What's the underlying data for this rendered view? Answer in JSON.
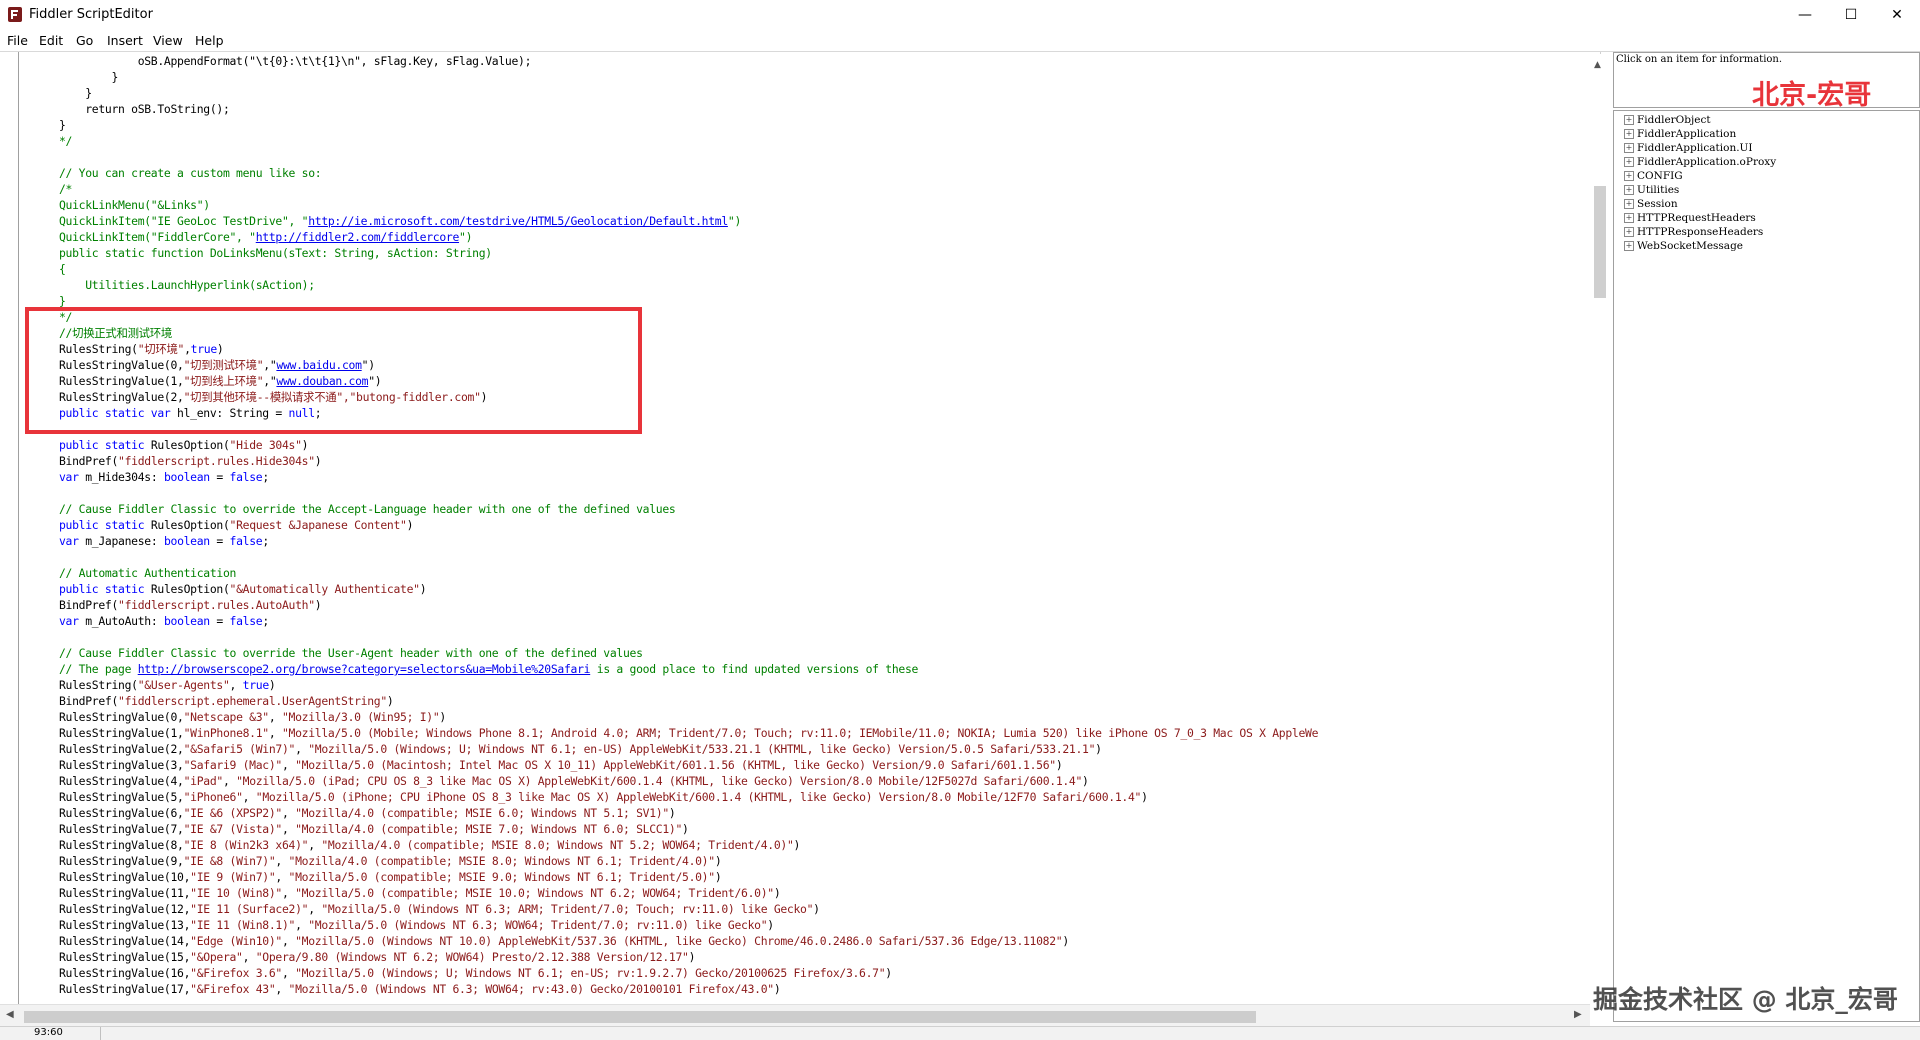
{
  "window": {
    "title": "Fiddler ScriptEditor",
    "minimize_symbol": "—",
    "maximize_symbol": "☐",
    "close_symbol": "✕",
    "icon": "fiddler-icon"
  },
  "menu": [
    "File",
    "Edit",
    "Go",
    "Insert",
    "View",
    "Help"
  ],
  "info_panel": {
    "hint": "Click on an item for information.",
    "watermark": "北京-宏哥"
  },
  "tree": [
    {
      "label": "FiddlerObject",
      "expander": "+"
    },
    {
      "label": "FiddlerApplication",
      "expander": "+"
    },
    {
      "label": "FiddlerApplication.UI",
      "expander": "+"
    },
    {
      "label": "FiddlerApplication.oProxy",
      "expander": "+"
    },
    {
      "label": "CONFIG",
      "expander": "+"
    },
    {
      "label": "Utilities",
      "expander": "+"
    },
    {
      "label": "Session",
      "expander": "+"
    },
    {
      "label": "HTTPRequestHeaders",
      "expander": "+"
    },
    {
      "label": "HTTPResponseHeaders",
      "expander": "+"
    },
    {
      "label": "WebSocketMessage",
      "expander": "+"
    }
  ],
  "code_lines": [
    [
      [
        "p",
        "            oSB.AppendFormat(\"\\t{0}:\\t\\t{1}\\n\", sFlag.Key, sFlag.Value);"
      ]
    ],
    [
      [
        "p",
        "        }"
      ]
    ],
    [
      [
        "p",
        "    }"
      ]
    ],
    [
      [
        "p",
        "    return oSB.ToString();"
      ]
    ],
    [
      [
        "p",
        "}"
      ]
    ],
    [
      [
        "c",
        "*/"
      ]
    ],
    [
      [
        "p",
        ""
      ]
    ],
    [
      [
        "c",
        "// You can create a custom menu like so:"
      ]
    ],
    [
      [
        "c",
        "/*"
      ]
    ],
    [
      [
        "c",
        "QuickLinkMenu(\"&Links\")"
      ]
    ],
    [
      [
        "c",
        "QuickLinkItem(\"IE GeoLoc TestDrive\", \""
      ],
      [
        "u",
        "http://ie.microsoft.com/testdrive/HTML5/Geolocation/Default.html"
      ],
      [
        "c",
        "\")"
      ]
    ],
    [
      [
        "c",
        "QuickLinkItem(\"FiddlerCore\", \""
      ],
      [
        "u",
        "http://fiddler2.com/fiddlercore"
      ],
      [
        "c",
        "\")"
      ]
    ],
    [
      [
        "c",
        "public static function DoLinksMenu(sText: String, sAction: String)"
      ]
    ],
    [
      [
        "c",
        "{"
      ]
    ],
    [
      [
        "c",
        "    Utilities.LaunchHyperlink(sAction);"
      ]
    ],
    [
      [
        "c",
        "}"
      ]
    ],
    [
      [
        "c",
        "*/"
      ]
    ],
    [
      [
        "c",
        "//切换正式和测试环境"
      ]
    ],
    [
      [
        "p",
        "RulesString("
      ],
      [
        "s",
        "\"切环境\""
      ],
      [
        "p",
        ","
      ],
      [
        "k",
        "true"
      ],
      [
        "p",
        ")"
      ]
    ],
    [
      [
        "p",
        "RulesStringValue(0,"
      ],
      [
        "s",
        "\"切到测试环境\""
      ],
      [
        "p",
        ",\""
      ],
      [
        "u",
        "www.baidu.com"
      ],
      [
        "p",
        "\")"
      ]
    ],
    [
      [
        "p",
        "RulesStringValue(1,"
      ],
      [
        "s",
        "\"切到线上环境\""
      ],
      [
        "p",
        ",\""
      ],
      [
        "u",
        "www.douban.com"
      ],
      [
        "p",
        "\")"
      ]
    ],
    [
      [
        "p",
        "RulesStringValue(2,"
      ],
      [
        "s",
        "\"切到其他环境--模拟请求不通\",\"butong-fiddler.com\""
      ],
      [
        "p",
        ")"
      ]
    ],
    [
      [
        "k",
        "public static var"
      ],
      [
        "p",
        " hl_env: String = "
      ],
      [
        "k",
        "null"
      ],
      [
        "p",
        ";"
      ]
    ],
    [
      [
        "p",
        ""
      ]
    ],
    [
      [
        "k",
        "public static"
      ],
      [
        "p",
        " RulesOption("
      ],
      [
        "s",
        "\"Hide 304s\""
      ],
      [
        "p",
        ")"
      ]
    ],
    [
      [
        "p",
        "BindPref("
      ],
      [
        "s",
        "\"fiddlerscript.rules.Hide304s\""
      ],
      [
        "p",
        ")"
      ]
    ],
    [
      [
        "k",
        "var"
      ],
      [
        "p",
        " m_Hide304s: "
      ],
      [
        "k",
        "boolean"
      ],
      [
        "p",
        " = "
      ],
      [
        "k",
        "false"
      ],
      [
        "p",
        ";"
      ]
    ],
    [
      [
        "p",
        ""
      ]
    ],
    [
      [
        "c",
        "// Cause Fiddler Classic to override the Accept-Language header with one of the defined values"
      ]
    ],
    [
      [
        "k",
        "public static"
      ],
      [
        "p",
        " RulesOption("
      ],
      [
        "s",
        "\"Request &Japanese Content\""
      ],
      [
        "p",
        ")"
      ]
    ],
    [
      [
        "k",
        "var"
      ],
      [
        "p",
        " m_Japanese: "
      ],
      [
        "k",
        "boolean"
      ],
      [
        "p",
        " = "
      ],
      [
        "k",
        "false"
      ],
      [
        "p",
        ";"
      ]
    ],
    [
      [
        "p",
        ""
      ]
    ],
    [
      [
        "c",
        "// Automatic Authentication"
      ]
    ],
    [
      [
        "k",
        "public static"
      ],
      [
        "p",
        " RulesOption("
      ],
      [
        "s",
        "\"&Automatically Authenticate\""
      ],
      [
        "p",
        ")"
      ]
    ],
    [
      [
        "p",
        "BindPref("
      ],
      [
        "s",
        "\"fiddlerscript.rules.AutoAuth\""
      ],
      [
        "p",
        ")"
      ]
    ],
    [
      [
        "k",
        "var"
      ],
      [
        "p",
        " m_AutoAuth: "
      ],
      [
        "k",
        "boolean"
      ],
      [
        "p",
        " = "
      ],
      [
        "k",
        "false"
      ],
      [
        "p",
        ";"
      ]
    ],
    [
      [
        "p",
        ""
      ]
    ],
    [
      [
        "c",
        "// Cause Fiddler Classic to override the User-Agent header with one of the defined values"
      ]
    ],
    [
      [
        "c",
        "// The page "
      ],
      [
        "u",
        "http://browserscope2.org/browse?category=selectors&ua=Mobile%20Safari"
      ],
      [
        "c",
        " is a good place to find updated versions of these"
      ]
    ],
    [
      [
        "p",
        "RulesString("
      ],
      [
        "s",
        "\"&User-Agents\""
      ],
      [
        "p",
        ", "
      ],
      [
        "k",
        "true"
      ],
      [
        "p",
        ")"
      ]
    ],
    [
      [
        "p",
        "BindPref("
      ],
      [
        "s",
        "\"fiddlerscript.ephemeral.UserAgentString\""
      ],
      [
        "p",
        ")"
      ]
    ],
    [
      [
        "p",
        "RulesStringValue(0,"
      ],
      [
        "s",
        "\"Netscape &3\""
      ],
      [
        "p",
        ", "
      ],
      [
        "s",
        "\"Mozilla/3.0 (Win95; I)\""
      ],
      [
        "p",
        ")"
      ]
    ],
    [
      [
        "p",
        "RulesStringValue(1,"
      ],
      [
        "s",
        "\"WinPhone8.1\""
      ],
      [
        "p",
        ", "
      ],
      [
        "s",
        "\"Mozilla/5.0 (Mobile; Windows Phone 8.1; Android 4.0; ARM; Trident/7.0; Touch; rv:11.0; IEMobile/11.0; NOKIA; Lumia 520) like iPhone OS 7_0_3 Mac OS X AppleWe"
      ]
    ],
    [
      [
        "p",
        "RulesStringValue(2,"
      ],
      [
        "s",
        "\"&Safari5 (Win7)\""
      ],
      [
        "p",
        ", "
      ],
      [
        "s",
        "\"Mozilla/5.0 (Windows; U; Windows NT 6.1; en-US) AppleWebKit/533.21.1 (KHTML, like Gecko) Version/5.0.5 Safari/533.21.1\""
      ],
      [
        "p",
        ")"
      ]
    ],
    [
      [
        "p",
        "RulesStringValue(3,"
      ],
      [
        "s",
        "\"Safari9 (Mac)\""
      ],
      [
        "p",
        ", "
      ],
      [
        "s",
        "\"Mozilla/5.0 (Macintosh; Intel Mac OS X 10_11) AppleWebKit/601.1.56 (KHTML, like Gecko) Version/9.0 Safari/601.1.56\""
      ],
      [
        "p",
        ")"
      ]
    ],
    [
      [
        "p",
        "RulesStringValue(4,"
      ],
      [
        "s",
        "\"iPad\""
      ],
      [
        "p",
        ", "
      ],
      [
        "s",
        "\"Mozilla/5.0 (iPad; CPU OS 8_3 like Mac OS X) AppleWebKit/600.1.4 (KHTML, like Gecko) Version/8.0 Mobile/12F5027d Safari/600.1.4\""
      ],
      [
        "p",
        ")"
      ]
    ],
    [
      [
        "p",
        "RulesStringValue(5,"
      ],
      [
        "s",
        "\"iPhone6\""
      ],
      [
        "p",
        ", "
      ],
      [
        "s",
        "\"Mozilla/5.0 (iPhone; CPU iPhone OS 8_3 like Mac OS X) AppleWebKit/600.1.4 (KHTML, like Gecko) Version/8.0 Mobile/12F70 Safari/600.1.4\""
      ],
      [
        "p",
        ")"
      ]
    ],
    [
      [
        "p",
        "RulesStringValue(6,"
      ],
      [
        "s",
        "\"IE &6 (XPSP2)\""
      ],
      [
        "p",
        ", "
      ],
      [
        "s",
        "\"Mozilla/4.0 (compatible; MSIE 6.0; Windows NT 5.1; SV1)\""
      ],
      [
        "p",
        ")"
      ]
    ],
    [
      [
        "p",
        "RulesStringValue(7,"
      ],
      [
        "s",
        "\"IE &7 (Vista)\""
      ],
      [
        "p",
        ", "
      ],
      [
        "s",
        "\"Mozilla/4.0 (compatible; MSIE 7.0; Windows NT 6.0; SLCC1)\""
      ],
      [
        "p",
        ")"
      ]
    ],
    [
      [
        "p",
        "RulesStringValue(8,"
      ],
      [
        "s",
        "\"IE 8 (Win2k3 x64)\""
      ],
      [
        "p",
        ", "
      ],
      [
        "s",
        "\"Mozilla/4.0 (compatible; MSIE 8.0; Windows NT 5.2; WOW64; Trident/4.0)\""
      ],
      [
        "p",
        ")"
      ]
    ],
    [
      [
        "p",
        "RulesStringValue(9,"
      ],
      [
        "s",
        "\"IE &8 (Win7)\""
      ],
      [
        "p",
        ", "
      ],
      [
        "s",
        "\"Mozilla/4.0 (compatible; MSIE 8.0; Windows NT 6.1; Trident/4.0)\""
      ],
      [
        "p",
        ")"
      ]
    ],
    [
      [
        "p",
        "RulesStringValue(10,"
      ],
      [
        "s",
        "\"IE 9 (Win7)\""
      ],
      [
        "p",
        ", "
      ],
      [
        "s",
        "\"Mozilla/5.0 (compatible; MSIE 9.0; Windows NT 6.1; Trident/5.0)\""
      ],
      [
        "p",
        ")"
      ]
    ],
    [
      [
        "p",
        "RulesStringValue(11,"
      ],
      [
        "s",
        "\"IE 10 (Win8)\""
      ],
      [
        "p",
        ", "
      ],
      [
        "s",
        "\"Mozilla/5.0 (compatible; MSIE 10.0; Windows NT 6.2; WOW64; Trident/6.0)\""
      ],
      [
        "p",
        ")"
      ]
    ],
    [
      [
        "p",
        "RulesStringValue(12,"
      ],
      [
        "s",
        "\"IE 11 (Surface2)\""
      ],
      [
        "p",
        ", "
      ],
      [
        "s",
        "\"Mozilla/5.0 (Windows NT 6.3; ARM; Trident/7.0; Touch; rv:11.0) like Gecko\""
      ],
      [
        "p",
        ")"
      ]
    ],
    [
      [
        "p",
        "RulesStringValue(13,"
      ],
      [
        "s",
        "\"IE 11 (Win8.1)\""
      ],
      [
        "p",
        ", "
      ],
      [
        "s",
        "\"Mozilla/5.0 (Windows NT 6.3; WOW64; Trident/7.0; rv:11.0) like Gecko\""
      ],
      [
        "p",
        ")"
      ]
    ],
    [
      [
        "p",
        "RulesStringValue(14,"
      ],
      [
        "s",
        "\"Edge (Win10)\""
      ],
      [
        "p",
        ", "
      ],
      [
        "s",
        "\"Mozilla/5.0 (Windows NT 10.0) AppleWebKit/537.36 (KHTML, like Gecko) Chrome/46.0.2486.0 Safari/537.36 Edge/13.11082\""
      ],
      [
        "p",
        ")"
      ]
    ],
    [
      [
        "p",
        "RulesStringValue(15,"
      ],
      [
        "s",
        "\"&Opera\""
      ],
      [
        "p",
        ", "
      ],
      [
        "s",
        "\"Opera/9.80 (Windows NT 6.2; WOW64) Presto/2.12.388 Version/12.17\""
      ],
      [
        "p",
        ")"
      ]
    ],
    [
      [
        "p",
        "RulesStringValue(16,"
      ],
      [
        "s",
        "\"&Firefox 3.6\""
      ],
      [
        "p",
        ", "
      ],
      [
        "s",
        "\"Mozilla/5.0 (Windows; U; Windows NT 6.1; en-US; rv:1.9.2.7) Gecko/20100625 Firefox/3.6.7\""
      ],
      [
        "p",
        ")"
      ]
    ],
    [
      [
        "p",
        "RulesStringValue(17,"
      ],
      [
        "s",
        "\"&Firefox 43\""
      ],
      [
        "p",
        ", "
      ],
      [
        "s",
        "\"Mozilla/5.0 (Windows NT 6.3; WOW64; rv:43.0) Gecko/20100101 Firefox/43.0\""
      ],
      [
        "p",
        ")"
      ]
    ]
  ],
  "status": {
    "position": "93:60"
  },
  "watermark_bottom": "掘金技术社区 @ 北京_宏哥",
  "colors": {
    "highlight_border": "#e8343a",
    "comment": "#008000",
    "keyword": "#0000ff",
    "string": "#8b1a1a"
  }
}
